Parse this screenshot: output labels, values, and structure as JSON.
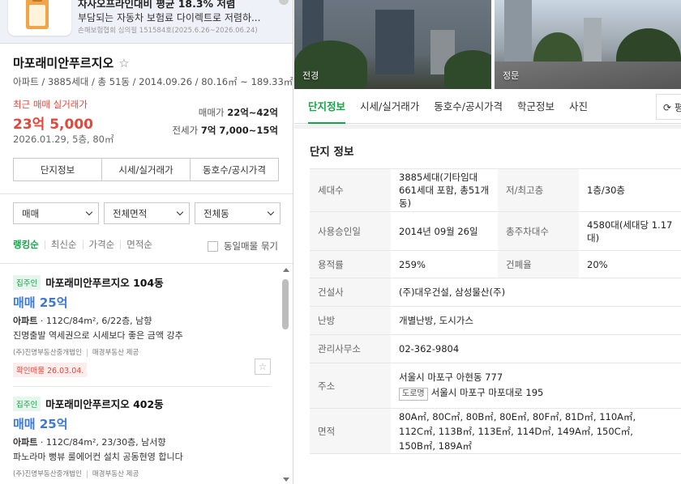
{
  "ad": {
    "title": "자사오프라인대비 평균 18.3% 저렴",
    "subtitle": "부담되는 자동차 보험료 다이렉트로 저렴하...",
    "note": "손해보험협회 심의필 151584호(2025.6.26~2026.06.24)"
  },
  "complex": {
    "name": "마포래미안푸르지오",
    "meta": "아파트 / 3885세대 / 총 51동 / 2014.09.26 / 80.16㎡ ~ 189.33㎡",
    "recent_label": "최근 매매 실거래가",
    "recent_price": "23억 5,000",
    "recent_date": "2026.01.29, 5층, 80㎡",
    "sale_label": "매매가",
    "sale_range": "22억~42억",
    "jeonse_label": "전세가",
    "jeonse_range": "7억 7,000~15억"
  },
  "left_tabs": [
    "단지정보",
    "시세/실거래가",
    "동호수/공시가격"
  ],
  "filters": [
    "매매",
    "전체면적",
    "전체동"
  ],
  "sorts": [
    "랭킹순",
    "최신순",
    "가격순",
    "면적순"
  ],
  "same_bundle_label": "동일매물 묶기",
  "listings": [
    {
      "badge": "집주인",
      "title": "마포래미안푸르지오 104동",
      "price": "매매 25억",
      "desc_type": "아파트",
      "desc_rest": " · 112C/84m², 6/22층, 남향",
      "note": "진명출발 역세권으로 시세보다 좋은 금액 강추",
      "agent": "(주)진명부동산중개법인",
      "provider": "매경부동산 제공",
      "confirm": "확인매물 26.03.04."
    },
    {
      "badge": "집주인",
      "title": "마포래미안푸르지오 402동",
      "price": "매매 25억",
      "desc_type": "아파트",
      "desc_rest": " · 112C/84m², 23/30층, 남서향",
      "note": "파노라마 뻥뷰 룰에어컨 설치 공동현영 합니다",
      "agent": "(주)진명부동산중개법인",
      "provider": "매경부동산 제공"
    }
  ],
  "photos": [
    {
      "label": "전경"
    },
    {
      "label": "정문"
    }
  ],
  "right_tabs": [
    "단지정보",
    "시세/실거래가",
    "동호수/공시가격",
    "학군정보",
    "사진"
  ],
  "right_more": "⟳ 평",
  "info": {
    "title": "단지 정보",
    "households_label": "세대수",
    "households_value": "3885세대(기타임대 661세대 포함, 총51개동)",
    "floors_label": "저/최고층",
    "floors_value": "1층/30층",
    "approval_label": "사용승인일",
    "approval_value": "2014년 09월 26일",
    "parking_label": "총주차대수",
    "parking_value": "4580대(세대당 1.17대)",
    "far_label": "용적률",
    "far_value": "259%",
    "bcr_label": "건폐율",
    "bcr_value": "20%",
    "builder_label": "건설사",
    "builder_value": "(주)대우건설, 삼성물산(주)",
    "heating_label": "난방",
    "heating_value": "개별난방, 도시가스",
    "office_label": "관리사무소",
    "office_value": "02-362-9804",
    "address_label": "주소",
    "address_value": "서울시 마포구 아현동 777",
    "road_tag": "도로명",
    "road_value": "서울시 마포구 마포대로 195",
    "area_label": "면적",
    "area_value": "80A㎡, 80C㎡, 80B㎡, 80E㎡, 80F㎡, 81D㎡, 110A㎡, 112C㎡, 113B㎡, 113E㎡, 114D㎡, 149A㎡, 150C㎡, 150B㎡, 189A㎡"
  }
}
